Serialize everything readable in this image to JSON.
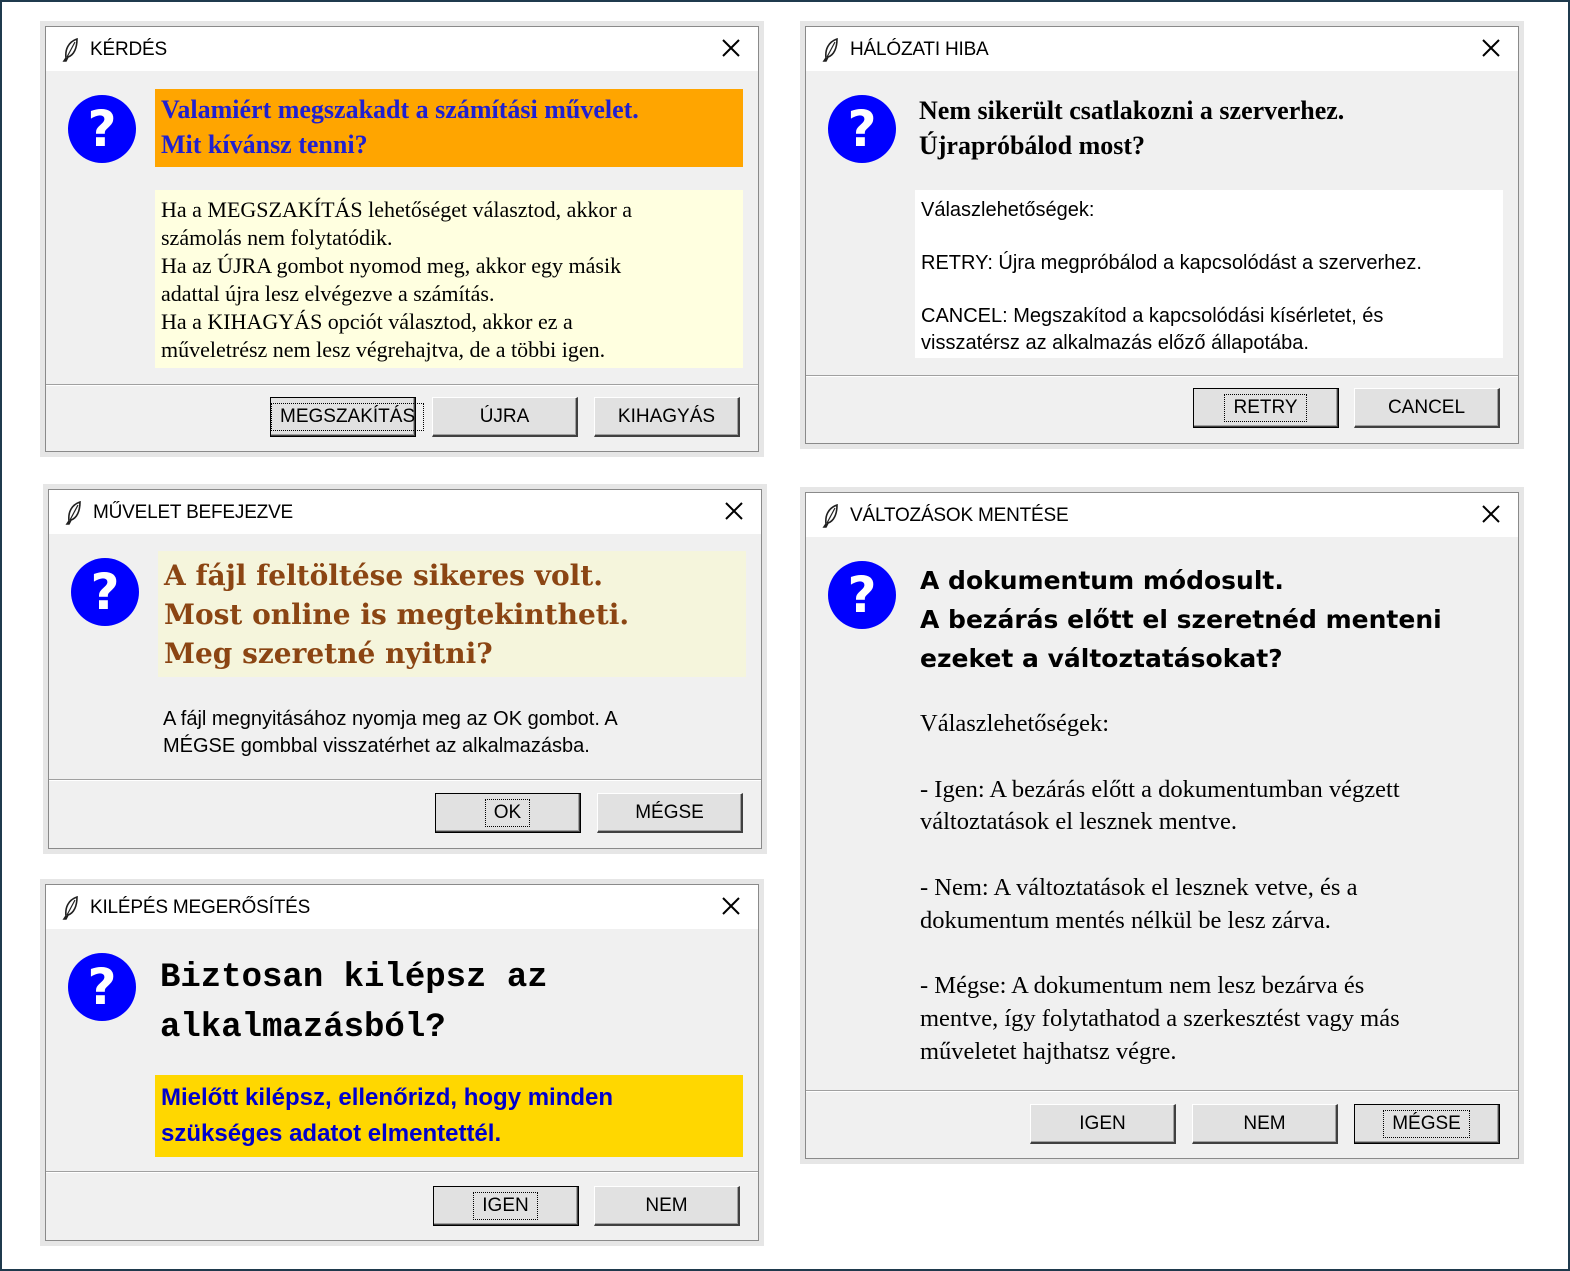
{
  "dialogs": {
    "kerdes": {
      "title": "KÉRDÉS",
      "message": "Valamiért megszakadt a számítási művelet.\nMit kívánsz tenni?",
      "detail": "Ha a MEGSZAKÍTÁS lehetőséget választod, akkor a\nszámolás nem folytatódik.\nHa az ÚJRA gombot nyomod meg, akkor egy másik\nadattal újra lesz elvégezve a számítás.\nHa a KIHAGYÁS opciót választod, akkor ez a\nműveletrész nem lesz végrehajtva, de a többi igen.",
      "buttons": [
        "MEGSZAKÍTÁS",
        "ÚJRA",
        "KIHAGYÁS"
      ]
    },
    "halozati": {
      "title": "HÁLÓZATI HIBA",
      "message": "Nem sikerült csatlakozni a szerverhez.\nÚjrapróbálod most?",
      "detail": "Válaszlehetőségek:\n\nRETRY: Újra megpróbálod a kapcsolódást a szerverhez.\n\nCANCEL: Megszakítod a kapcsolódási kísérletet, és\nvisszatérsz az alkalmazás előző állapotába.",
      "buttons": [
        "RETRY",
        "CANCEL"
      ]
    },
    "muvelet": {
      "title": "MŰVELET BEFEJEZVE",
      "message": "A fájl feltöltése sikeres volt.\nMost online is megtekintheti.\nMeg szeretné nyitni?",
      "detail": "A fájl megnyitásához nyomja meg az OK gombot. A\nMÉGSE gombbal visszatérhet az alkalmazásba.",
      "buttons": [
        "OK",
        "MÉGSE"
      ]
    },
    "valtozasok": {
      "title": "VÁLTOZÁSOK MENTÉSE",
      "message": "A dokumentum módosult.\nA bezárás előtt el szeretnéd menteni\nezeket a változtatásokat?",
      "detail": "Válaszlehetőségek:\n\n - Igen: A bezárás előtt a dokumentumban végzett\nváltoztatások el lesznek mentve.\n\n - Nem: A változtatások el lesznek vetve, és a\ndokumentum mentés nélkül be lesz zárva.\n\n - Mégse: A dokumentum nem lesz bezárva és\nmentve, így folytathatod a szerkesztést vagy más\nműveletet hajthatsz végre.",
      "buttons": [
        "IGEN",
        "NEM",
        "MÉGSE"
      ]
    },
    "kilepes": {
      "title": "KILÉPÉS MEGERŐSÍTÉS",
      "message": "Biztosan kilépsz az\nalkalmazásból?",
      "detail": "Mielőtt kilépsz, ellenőrizd, hogy minden\nszükséges adatot elmentettél.",
      "buttons": [
        "IGEN",
        "NEM"
      ]
    }
  },
  "colors": {
    "kerdes_message_bg": "#ffa500",
    "kerdes_message_fg": "#2020d0",
    "kerdes_detail_bg": "#ffffe0",
    "halozati_detail_bg": "#ffffff",
    "muvelet_message_bg": "#f5f5dc",
    "muvelet_message_fg": "#8b4513",
    "kilepes_detail_bg": "#ffd700",
    "kilepes_detail_fg": "#0000cd",
    "question_icon": "#0000ff"
  }
}
